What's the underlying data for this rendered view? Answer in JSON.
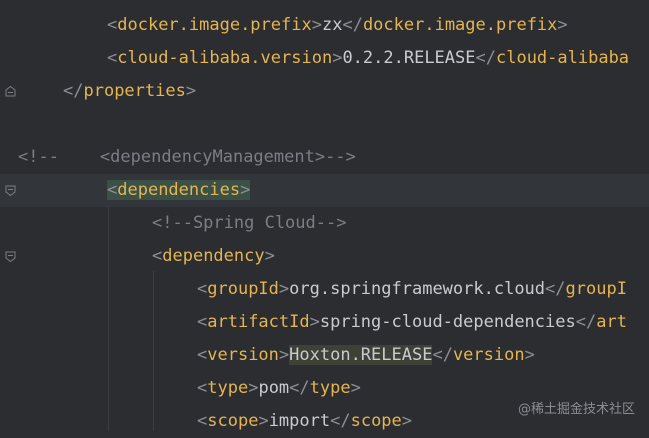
{
  "lines": [
    {
      "parts": [
        [
          "b",
          "<"
        ],
        [
          "t",
          "docker.image.prefix"
        ],
        [
          "b",
          ">"
        ],
        [
          "txt",
          "zx"
        ],
        [
          "b",
          "</"
        ],
        [
          "t",
          "docker.image.prefix"
        ],
        [
          "b",
          ">"
        ]
      ]
    },
    {
      "parts": [
        [
          "b",
          "<"
        ],
        [
          "t",
          "cloud-alibaba.version"
        ],
        [
          "b",
          ">"
        ],
        [
          "txt",
          "0.2.2.RELEASE"
        ],
        [
          "b",
          "</"
        ],
        [
          "t",
          "cloud-alibaba"
        ]
      ]
    },
    {
      "parts": [
        [
          "b",
          "</"
        ],
        [
          "t",
          "properties"
        ],
        [
          "b",
          ">"
        ]
      ]
    },
    {
      "parts": []
    },
    {
      "parts": [
        [
          "cm",
          "<!--"
        ],
        [
          "cm",
          "    "
        ],
        [
          "cm",
          "<dependencyManagement>-->"
        ]
      ]
    },
    {
      "parts": [
        [
          "b",
          "<"
        ],
        [
          "t",
          "dependencies"
        ],
        [
          "b",
          ">"
        ]
      ]
    },
    {
      "parts": [
        [
          "cm",
          "<!--Spring Cloud-->"
        ]
      ]
    },
    {
      "parts": [
        [
          "b",
          "<"
        ],
        [
          "t",
          "dependency"
        ],
        [
          "b",
          ">"
        ]
      ]
    },
    {
      "parts": [
        [
          "b",
          "<"
        ],
        [
          "t",
          "groupId"
        ],
        [
          "b",
          ">"
        ],
        [
          "txt",
          "org.springframework.cloud"
        ],
        [
          "b",
          "</"
        ],
        [
          "t",
          "groupI"
        ]
      ]
    },
    {
      "parts": [
        [
          "b",
          "<"
        ],
        [
          "t",
          "artifactId"
        ],
        [
          "b",
          ">"
        ],
        [
          "txt",
          "spring-cloud-dependencies"
        ],
        [
          "b",
          "</"
        ],
        [
          "t",
          "art"
        ]
      ]
    },
    {
      "parts": [
        [
          "b",
          "<"
        ],
        [
          "t",
          "version"
        ],
        [
          "b",
          ">"
        ],
        [
          "txt",
          "Hoxton.RELEASE"
        ],
        [
          "b",
          "</"
        ],
        [
          "t",
          "version"
        ],
        [
          "b",
          ">"
        ]
      ]
    },
    {
      "parts": [
        [
          "b",
          "<"
        ],
        [
          "t",
          "type"
        ],
        [
          "b",
          ">"
        ],
        [
          "txt",
          "pom"
        ],
        [
          "b",
          "</"
        ],
        [
          "t",
          "type"
        ],
        [
          "b",
          ">"
        ]
      ]
    },
    {
      "parts": [
        [
          "b",
          "<"
        ],
        [
          "t",
          "scope"
        ],
        [
          "b",
          ">"
        ],
        [
          "txt",
          "import"
        ],
        [
          "b",
          "</"
        ],
        [
          "t",
          "scope"
        ],
        [
          "b",
          ">"
        ]
      ]
    }
  ],
  "watermark": "@稀土掘金技术社区",
  "colors": {
    "background": "#2b2d30",
    "tag": "#e6b450",
    "text": "#c8cbd0",
    "comment": "#7a7e85"
  }
}
